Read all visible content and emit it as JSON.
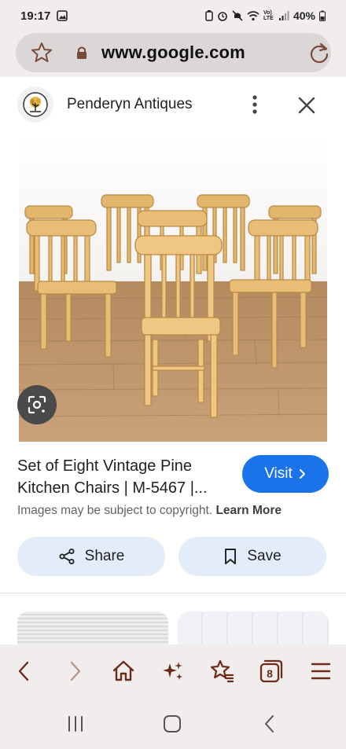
{
  "status_bar": {
    "time": "19:17",
    "network": "Vo) LTE",
    "battery": "40%"
  },
  "browser": {
    "url": "www.google.com"
  },
  "source": {
    "site_name": "Penderyn Antiques"
  },
  "result": {
    "title": "Set of Eight Vintage Pine Kitchen Chairs | M-5467 |...",
    "visit_label": "Visit",
    "copyright_notice": "Images may be subject to copyright.",
    "learn_more_label": "Learn More",
    "share_label": "Share",
    "save_label": "Save"
  },
  "toolbar": {
    "tab_count": "8",
    "icons": [
      "back-icon",
      "forward-icon",
      "home-icon",
      "ai-sparkle-icon",
      "bookmarks-icon",
      "tabs-icon",
      "menu-icon"
    ]
  },
  "colors": {
    "accent": "#1a73e8",
    "chrome_background": "#f2eded",
    "toolbar_icon": "#6b2c1a",
    "pill_button": "#e3edfa"
  }
}
